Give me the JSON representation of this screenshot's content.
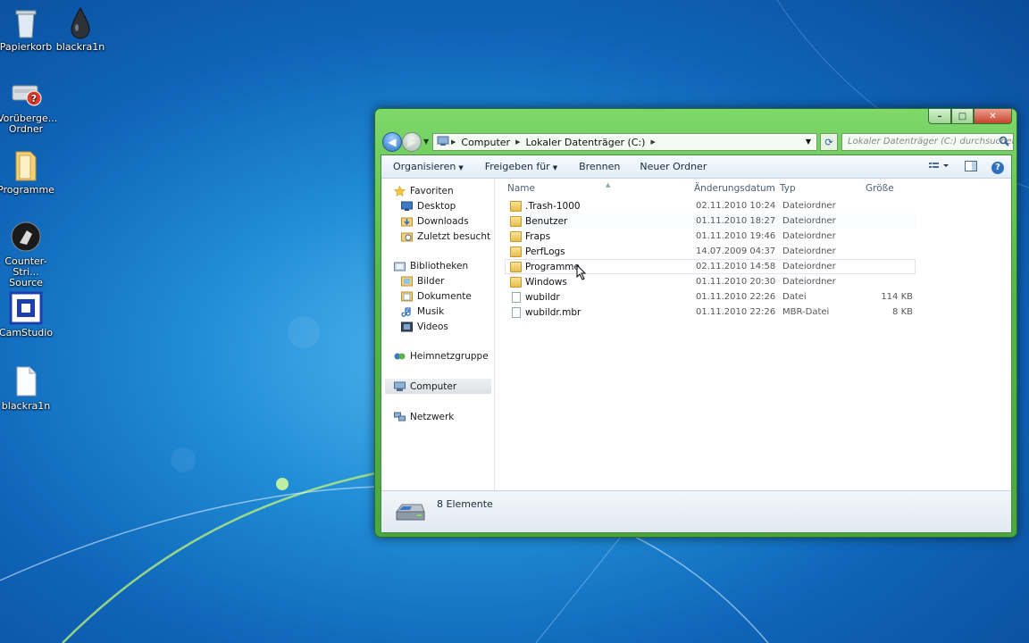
{
  "desktop": {
    "icons": [
      {
        "label": "Papierkorb",
        "icon": "recycle-bin-icon"
      },
      {
        "label": "blackra1n",
        "icon": "drop-icon"
      },
      {
        "label": "Vorüberge... Ordner",
        "icon": "temp-folder-icon"
      },
      {
        "label": "Programme",
        "icon": "folder-icon"
      },
      {
        "label": "Counter-Stri... Source",
        "icon": "counter-strike-icon"
      },
      {
        "label": "CamStudio",
        "icon": "camstudio-icon"
      },
      {
        "label": "blackra1n",
        "icon": "file-icon"
      }
    ]
  },
  "window": {
    "address": {
      "crumbs": [
        "Computer",
        "Lokaler Datenträger (C:)"
      ]
    },
    "search": {
      "placeholder": "Lokaler Datenträger (C:) durchsuchen"
    },
    "toolbar": {
      "organize": "Organisieren",
      "share": "Freigeben für",
      "burn": "Brennen",
      "new_folder": "Neuer Ordner"
    },
    "navpane": {
      "favorites": {
        "label": "Favoriten",
        "items": [
          "Desktop",
          "Downloads",
          "Zuletzt besucht"
        ]
      },
      "libraries": {
        "label": "Bibliotheken",
        "items": [
          "Bilder",
          "Dokumente",
          "Musik",
          "Videos"
        ]
      },
      "homegroup": "Heimnetzgruppe",
      "computer": "Computer",
      "network": "Netzwerk"
    },
    "columns": {
      "name": "Name",
      "date": "Änderungsdatum",
      "type": "Typ",
      "size": "Größe"
    },
    "files": [
      {
        "name": ".Trash-1000",
        "date": "02.11.2010 10:24",
        "type": "Dateiordner",
        "size": "",
        "kind": "folder"
      },
      {
        "name": "Benutzer",
        "date": "01.11.2010 18:27",
        "type": "Dateiordner",
        "size": "",
        "kind": "folder"
      },
      {
        "name": "Fraps",
        "date": "01.11.2010 19:46",
        "type": "Dateiordner",
        "size": "",
        "kind": "folder"
      },
      {
        "name": "PerfLogs",
        "date": "14.07.2009 04:37",
        "type": "Dateiordner",
        "size": "",
        "kind": "folder"
      },
      {
        "name": "Programme",
        "date": "02.11.2010 14:58",
        "type": "Dateiordner",
        "size": "",
        "kind": "folder"
      },
      {
        "name": "Windows",
        "date": "01.11.2010 20:30",
        "type": "Dateiordner",
        "size": "",
        "kind": "folder"
      },
      {
        "name": "wubildr",
        "date": "01.11.2010 22:26",
        "type": "Datei",
        "size": "114 KB",
        "kind": "file"
      },
      {
        "name": "wubildr.mbr",
        "date": "01.11.2010 22:26",
        "type": "MBR-Datei",
        "size": "8 KB",
        "kind": "file"
      }
    ],
    "status": {
      "count": "8 Elemente"
    }
  },
  "colors": {
    "window_frame": "#56b84a",
    "desktop_bg": "#1f8bd6",
    "selection": "#dbe6f2"
  }
}
